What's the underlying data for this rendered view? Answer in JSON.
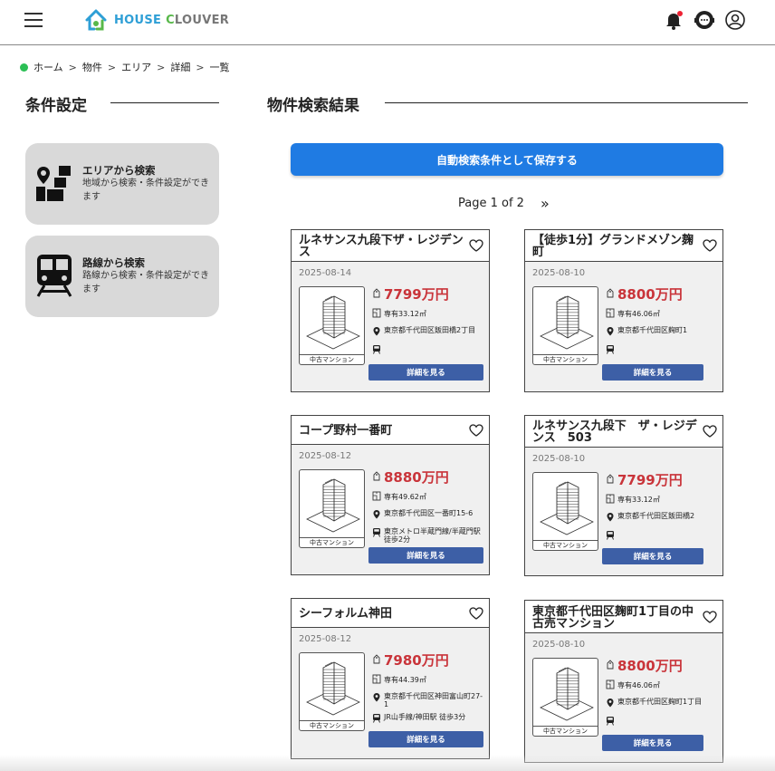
{
  "header": {
    "logo": {
      "part1": "HOUSE ",
      "part2": "C",
      "part3": "LOUVER"
    },
    "icons": [
      "menu-icon",
      "notification-bell-icon",
      "chat-support-icon",
      "user-account-icon"
    ]
  },
  "breadcrumb": [
    "ホーム",
    "物件",
    "エリア",
    "詳細",
    "一覧"
  ],
  "sidebar": {
    "title": "条件設定",
    "cards": [
      {
        "title": "エリアから検索",
        "desc": "地域から検索・条件設定ができます",
        "icon": "map-area-icon"
      },
      {
        "title": "路線から検索",
        "desc": "路線から検索・条件設定ができます",
        "icon": "train-icon"
      }
    ]
  },
  "main": {
    "title": "物件検索結果",
    "save_button": "自動検索条件として保存する",
    "pager": {
      "text": "Page 1 of 2",
      "next": "»"
    }
  },
  "listings": [
    {
      "name": "ルネサンス九段下ザ・レジデンス",
      "date": "2025-08-14",
      "price": "7799万円",
      "area": "専有33.12㎡",
      "address": "東京都千代田区飯田橋2丁目",
      "station": "",
      "thumb_label": "中古マンション",
      "button": "詳細を見る"
    },
    {
      "name": "【徒歩1分】グランドメゾン麹町",
      "date": "2025-08-10",
      "price": "8800万円",
      "area": "専有46.06㎡",
      "address": "東京都千代田区麹町1",
      "station": "",
      "thumb_label": "中古マンション",
      "button": "詳細を見る"
    },
    {
      "name": "コープ野村一番町",
      "date": "2025-08-12",
      "price": "8880万円",
      "area": "専有49.62㎡",
      "address": "東京都千代田区一番町15-6",
      "station": "東京メトロ半蔵門線/半蔵門駅 徒歩2分",
      "thumb_label": "中古マンション",
      "button": "詳細を見る"
    },
    {
      "name": "ルネサンス九段下　ザ・レジデンス　503",
      "date": "2025-08-10",
      "price": "7799万円",
      "area": "専有33.12㎡",
      "address": "東京都千代田区飯田橋2",
      "station": "",
      "thumb_label": "中古マンション",
      "button": "詳細を見る"
    },
    {
      "name": "シーフォルム神田",
      "date": "2025-08-12",
      "price": "7980万円",
      "area": "専有44.39㎡",
      "address": "東京都千代田区神田富山町27-1",
      "station": "JR山手線/神田駅 徒歩3分",
      "thumb_label": "中古マンション",
      "button": "詳細を見る"
    },
    {
      "name": "東京都千代田区麹町1丁目の中古売マンション",
      "date": "2025-08-10",
      "price": "8800万円",
      "area": "専有46.06㎡",
      "address": "東京都千代田区麹町1丁目",
      "station": "",
      "thumb_label": "中古マンション",
      "button": "詳細を見る"
    }
  ],
  "colors": {
    "accent": "#1f7be3",
    "price": "#c9343a",
    "detail_button": "#3d5fa6",
    "breadcrumb_dot": "#2bbf55"
  }
}
